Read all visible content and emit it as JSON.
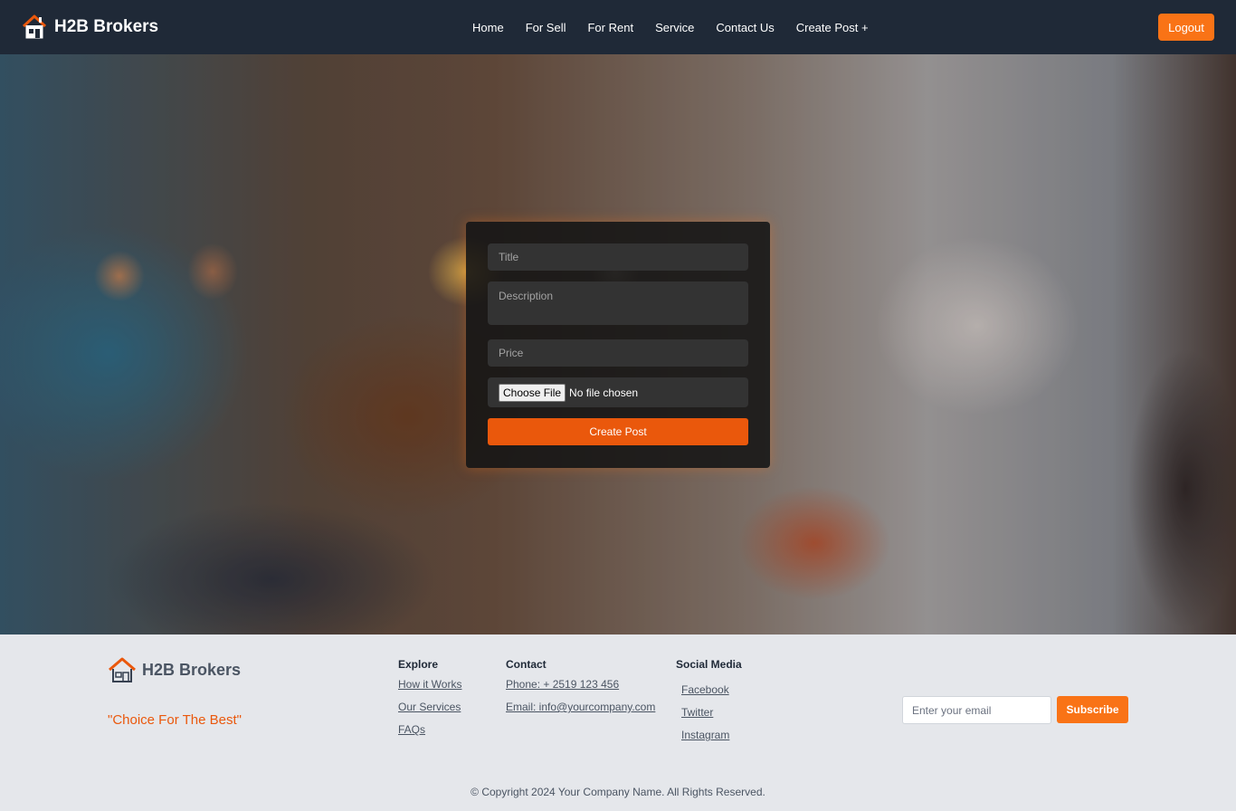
{
  "header": {
    "brand": "H2B Brokers",
    "logo_icon": "house-icon",
    "nav": [
      "Home",
      "For Sell",
      "For Rent",
      "Service",
      "Contact Us",
      "Create Post +"
    ],
    "logout_label": "Logout"
  },
  "form": {
    "title_placeholder": "Title",
    "description_placeholder": "Description",
    "price_placeholder": "Price",
    "file_button_label": "Choose File",
    "file_status": "No file chosen",
    "submit_label": "Create Post"
  },
  "footer": {
    "brand": "H2B Brokers",
    "tagline": "\"Choice For The Best\"",
    "explore": {
      "heading": "Explore",
      "links": [
        "How it Works",
        "Our Services",
        "FAQs"
      ]
    },
    "contact": {
      "heading": "Contact",
      "links": [
        "Phone: + 2519 123 456",
        "Email: info@yourcompany.com"
      ]
    },
    "social": {
      "heading": "Social Media",
      "links": [
        "Facebook",
        "Twitter",
        "Instagram"
      ]
    },
    "newsletter": {
      "email_placeholder": "Enter your email",
      "subscribe_label": "Subscribe"
    },
    "copyright": "© Copyright 2024 Your Company Name. All Rights Reserved."
  },
  "colors": {
    "header_bg": "#1f2937",
    "accent": "#f97316",
    "accent_dark": "#ea580c",
    "footer_bg": "#e5e7eb"
  }
}
